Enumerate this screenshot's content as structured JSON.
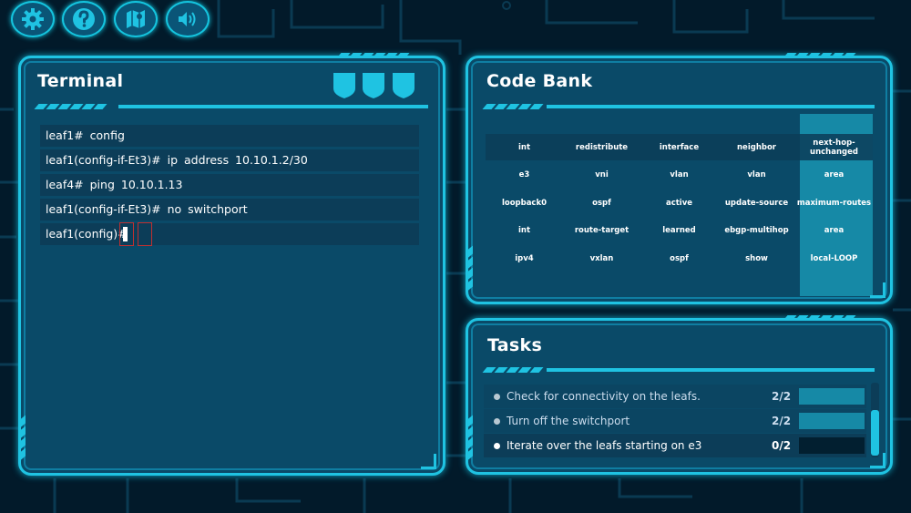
{
  "colors": {
    "accent": "#1fc3e2",
    "panel": "#0a4a68",
    "background": "#021a2a",
    "highlight": "#1689a6",
    "row": "#0c3d58"
  },
  "toolbar": [
    {
      "name": "settings",
      "icon": "gear-icon"
    },
    {
      "name": "help",
      "icon": "question-icon"
    },
    {
      "name": "map",
      "icon": "map-icon"
    },
    {
      "name": "sound",
      "icon": "speaker-icon"
    }
  ],
  "terminal": {
    "title": "Terminal",
    "lives": 3,
    "lines": [
      "leaf1# config",
      "leaf1(config-if-Et3)# ip address 10.10.1.2/30",
      "leaf4# ping 10.10.1.13",
      "leaf1(config-if-Et3)# no switchport"
    ],
    "prompt": "leaf1(config)#"
  },
  "code_bank": {
    "title": "Code Bank",
    "rows": [
      [
        "int",
        "redistribute",
        "interface",
        "neighbor",
        "next-hop-unchanged"
      ],
      [
        "e3",
        "vni",
        "vlan",
        "vlan",
        "area"
      ],
      [
        "loopback0",
        "ospf",
        "active",
        "update-source",
        "maximum-routes"
      ],
      [
        "int",
        "route-target",
        "learned",
        "ebgp-multihop",
        "area"
      ],
      [
        "ipv4",
        "vxlan",
        "ospf",
        "show",
        "local-LOOP"
      ]
    ]
  },
  "tasks": {
    "title": "Tasks",
    "items": [
      {
        "label": "Check for connectivity on the leafs.",
        "count": "2/2",
        "progress": 1.0,
        "done": true
      },
      {
        "label": "Turn off the switchport",
        "count": "2/2",
        "progress": 1.0,
        "done": true
      },
      {
        "label": "Iterate over the leafs starting on e3",
        "count": "0/2",
        "progress": 0.0,
        "done": false
      }
    ]
  }
}
